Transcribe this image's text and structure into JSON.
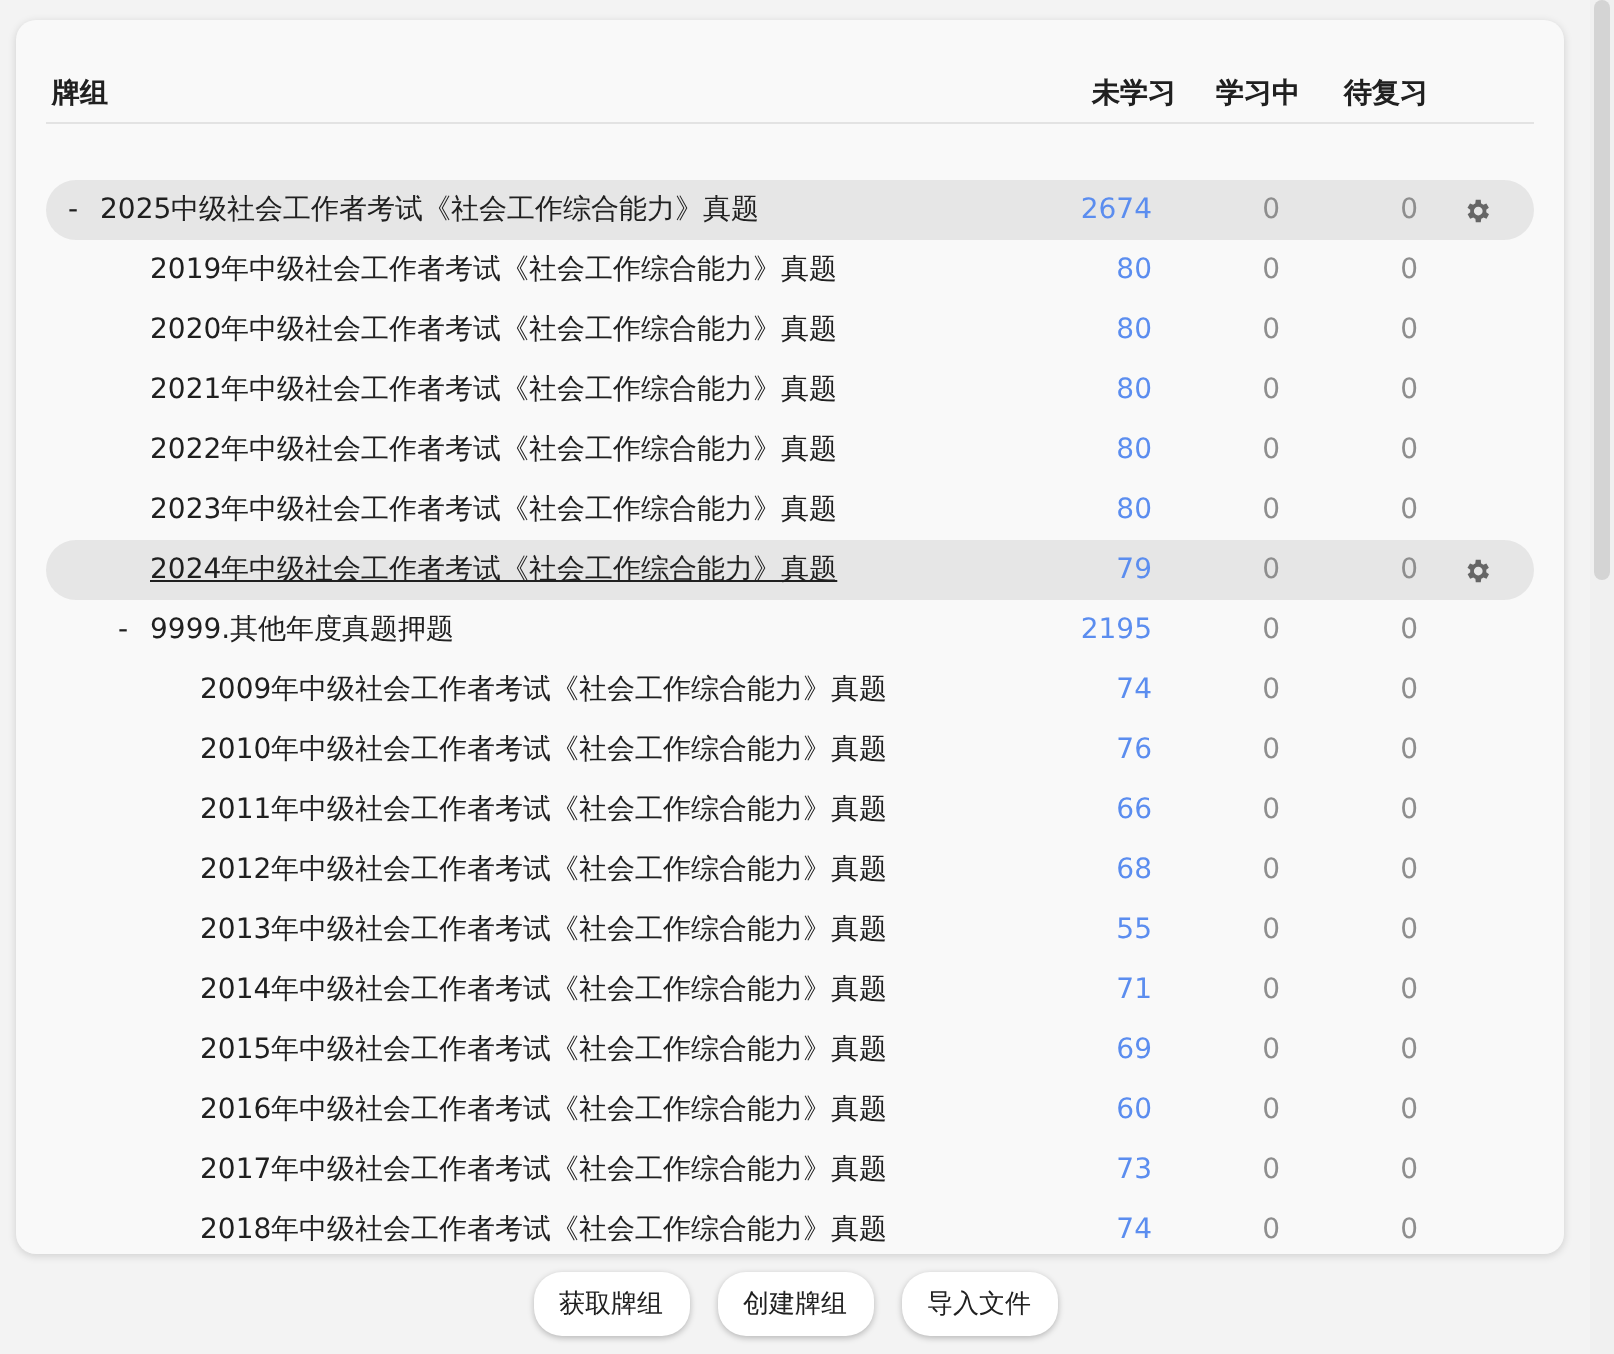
{
  "columns": {
    "deck": "牌组",
    "new": "未学习",
    "learn": "学习中",
    "due": "待复习"
  },
  "decks": [
    {
      "name": "2025中级社会工作者考试《社会工作综合能力》真题",
      "new": "2674",
      "learn": "0",
      "due": "0",
      "toggle": "-",
      "highlighted": true,
      "selected": false,
      "children": [
        {
          "name": "2019年中级社会工作者考试《社会工作综合能力》真题",
          "new": "80",
          "learn": "0",
          "due": "0",
          "highlighted": false,
          "selected": false
        },
        {
          "name": "2020年中级社会工作者考试《社会工作综合能力》真题",
          "new": "80",
          "learn": "0",
          "due": "0",
          "highlighted": false,
          "selected": false
        },
        {
          "name": "2021年中级社会工作者考试《社会工作综合能力》真题",
          "new": "80",
          "learn": "0",
          "due": "0",
          "highlighted": false,
          "selected": false
        },
        {
          "name": "2022年中级社会工作者考试《社会工作综合能力》真题",
          "new": "80",
          "learn": "0",
          "due": "0",
          "highlighted": false,
          "selected": false
        },
        {
          "name": "2023年中级社会工作者考试《社会工作综合能力》真题",
          "new": "80",
          "learn": "0",
          "due": "0",
          "highlighted": false,
          "selected": false
        },
        {
          "name": "2024年中级社会工作者考试《社会工作综合能力》真题",
          "new": "79",
          "learn": "0",
          "due": "0",
          "highlighted": true,
          "selected": true
        },
        {
          "name": "9999.其他年度真题押题",
          "new": "2195",
          "learn": "0",
          "due": "0",
          "toggle": "-",
          "highlighted": false,
          "selected": false,
          "children": [
            {
              "name": "2009年中级社会工作者考试《社会工作综合能力》真题",
              "new": "74",
              "learn": "0",
              "due": "0",
              "highlighted": false,
              "selected": false
            },
            {
              "name": "2010年中级社会工作者考试《社会工作综合能力》真题",
              "new": "76",
              "learn": "0",
              "due": "0",
              "highlighted": false,
              "selected": false
            },
            {
              "name": "2011年中级社会工作者考试《社会工作综合能力》真题",
              "new": "66",
              "learn": "0",
              "due": "0",
              "highlighted": false,
              "selected": false
            },
            {
              "name": "2012年中级社会工作者考试《社会工作综合能力》真题",
              "new": "68",
              "learn": "0",
              "due": "0",
              "highlighted": false,
              "selected": false
            },
            {
              "name": "2013年中级社会工作者考试《社会工作综合能力》真题",
              "new": "55",
              "learn": "0",
              "due": "0",
              "highlighted": false,
              "selected": false
            },
            {
              "name": "2014年中级社会工作者考试《社会工作综合能力》真题",
              "new": "71",
              "learn": "0",
              "due": "0",
              "highlighted": false,
              "selected": false
            },
            {
              "name": "2015年中级社会工作者考试《社会工作综合能力》真题",
              "new": "69",
              "learn": "0",
              "due": "0",
              "highlighted": false,
              "selected": false
            },
            {
              "name": "2016年中级社会工作者考试《社会工作综合能力》真题",
              "new": "60",
              "learn": "0",
              "due": "0",
              "highlighted": false,
              "selected": false
            },
            {
              "name": "2017年中级社会工作者考试《社会工作综合能力》真题",
              "new": "73",
              "learn": "0",
              "due": "0",
              "highlighted": false,
              "selected": false
            },
            {
              "name": "2018年中级社会工作者考试《社会工作综合能力》真题",
              "new": "74",
              "learn": "0",
              "due": "0",
              "highlighted": false,
              "selected": false
            }
          ]
        }
      ]
    }
  ],
  "buttons": [
    "获取牌组",
    "创建牌组",
    "导入文件"
  ]
}
